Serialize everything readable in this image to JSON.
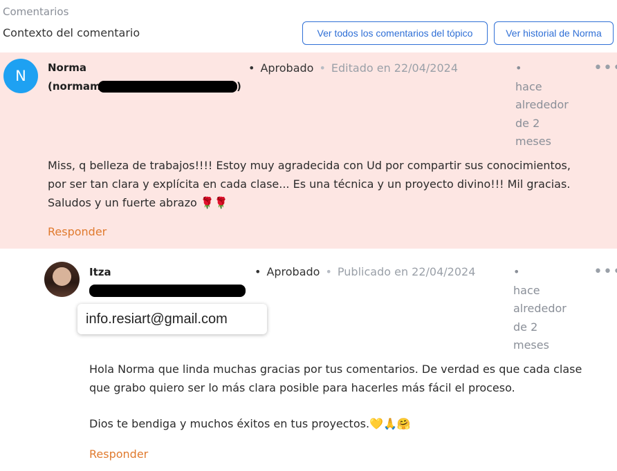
{
  "header": {
    "section_title": "Comentarios",
    "context_title": "Contexto del comentario",
    "btn_all": "Ver todos los comentarios del tópico",
    "btn_history": "Ver historial de Norma"
  },
  "comment1": {
    "avatar_letter": "N",
    "name": "Norma",
    "handle_prefix": "(normam",
    "handle_suffix": ")",
    "status": "Aprobado",
    "edited": "Editado en 22/04/2024",
    "time_lines": [
      "hace",
      "alrededor",
      "de 2",
      "meses"
    ],
    "more": "•••",
    "text": "Miss, q belleza de trabajos!!!! Estoy muy agradecida con Ud por compartir sus conocimientos, por ser tan clara y explícita en cada clase... Es una técnica y un proyecto divino!!! Mil gracias. Saludos y un fuerte abrazo 🌹🌹",
    "reply": "Responder"
  },
  "comment2": {
    "name": "Itza",
    "status": "Aprobado",
    "published": "Publicado en 22/04/2024",
    "time_lines": [
      "hace",
      "alrededor",
      "de 2",
      "meses"
    ],
    "more": "•••",
    "tooltip": "info.resiart@gmail.com",
    "text1": "Hola Norma que linda muchas gracias por tus comentarios. De verdad es que cada clase que grabo quiero ser lo más clara posible para hacerles más fácil el proceso.",
    "text2": "Dios te bendiga y muchos éxitos en tus proyectos.💛🙏🤗",
    "reply": "Responder"
  },
  "colors": {
    "accent_blue": "#2f6fd6",
    "reply_orange": "#e07a2e",
    "highlight_bg": "#fde6e3",
    "avatar_blue": "#1ea1f2"
  }
}
